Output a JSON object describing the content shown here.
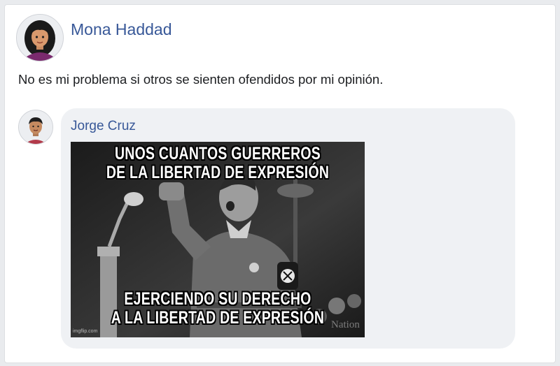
{
  "post": {
    "author": "Mona Haddad",
    "text": "No es mi problema si otros se sienten ofendidos por mi opinión."
  },
  "comment": {
    "author": "Jorge Cruz",
    "meme": {
      "top_caption_line1": "UNOS CUANTOS GUERREROS",
      "top_caption_line2": "DE LA LIBERTAD DE EXPRESIÓN",
      "bottom_caption_line1": "EJERCIENDO SU DERECHO",
      "bottom_caption_line2": "A LA LIBERTAD DE EXPRESIÓN",
      "watermark": "imgflip.com",
      "overlay_text": "Nation"
    }
  },
  "colors": {
    "author_link": "#385898",
    "bubble": "#eff1f4",
    "text": "#1c1e21"
  }
}
